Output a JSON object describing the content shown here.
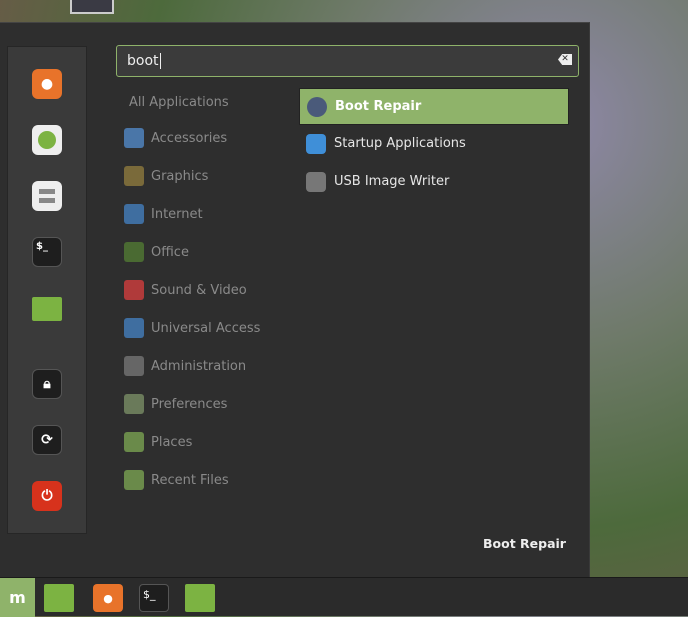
{
  "search": {
    "value": "boot",
    "clear_icon": "backspace-icon"
  },
  "categories_header": "All Applications",
  "categories": [
    {
      "label": "Accessories",
      "color": "#4a76a8"
    },
    {
      "label": "Graphics",
      "color": "#7a6a3a"
    },
    {
      "label": "Internet",
      "color": "#3f6ea0"
    },
    {
      "label": "Office",
      "color": "#4a6a32"
    },
    {
      "label": "Sound & Video",
      "color": "#b03a3a"
    },
    {
      "label": "Universal Access",
      "color": "#3f6ea0"
    },
    {
      "label": "Administration",
      "color": "#666666"
    },
    {
      "label": "Preferences",
      "color": "#6a7a5a"
    },
    {
      "label": "Places",
      "color": "#6a8a4a"
    },
    {
      "label": "Recent Files",
      "color": "#6a8a4a"
    }
  ],
  "results": [
    {
      "label": "Boot Repair",
      "selected": true
    },
    {
      "label": "Startup Applications"
    },
    {
      "label": "USB Image Writer"
    }
  ],
  "description": "Boot Repair",
  "favorites": [
    "firefox",
    "software-manager",
    "settings",
    "terminal",
    "files",
    "lock",
    "logout",
    "shutdown"
  ],
  "taskbar": {
    "terminal_prompt": "$_"
  },
  "accent": "#8fb36a"
}
